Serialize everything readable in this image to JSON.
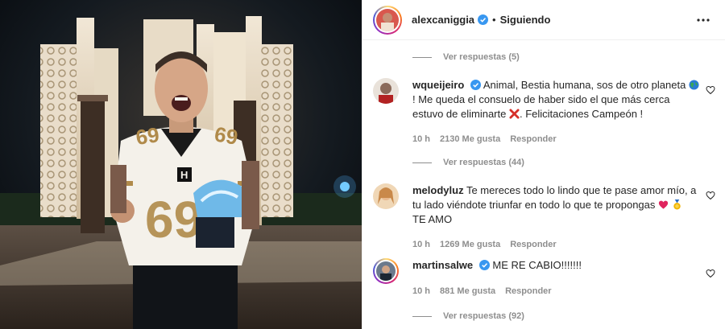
{
  "post": {
    "author": "alexcaniggia",
    "separator": "•",
    "follow_status": "Siguiendo",
    "more_icon": "more-options-icon"
  },
  "threads": [
    {
      "view_replies": "Ver respuestas (5)"
    },
    {
      "view_replies": "Ver respuestas (44)"
    },
    {
      "view_replies": "Ver respuestas (92)"
    }
  ],
  "comments": [
    {
      "user": "wqueijeiro",
      "verified": true,
      "text_part1": "Animal, Bestia humana, sos de otro planeta",
      "text_part2": "! Me queda el consuelo de haber sido el que más cerca estuvo de eliminarte",
      "text_part3": ". Felicitaciones Campeón !",
      "time": "10 h",
      "likes": "2130 Me gusta",
      "reply": "Responder"
    },
    {
      "user": "melodyluz",
      "verified": false,
      "text_part1": "Te mereces todo lo lindo que te pase amor mío, a tu lado viéndote triunfar en todo lo que te propongas",
      "text_part2": "TE AMO",
      "time": "10 h",
      "likes": "1269 Me gusta",
      "reply": "Responder"
    },
    {
      "user": "martinsalwe",
      "verified": true,
      "text_part1": "ME RE CABIO!!!!!!!",
      "time": "10 h",
      "likes": "881 Me gusta",
      "reply": "Responder"
    }
  ],
  "photo": {
    "jersey_number": "69",
    "jersey_letter": "H"
  },
  "colors": {
    "verified_blue": "#3897f0",
    "muted_text": "#8e8e8e",
    "text": "#262626",
    "jersey_gold": "#b08a4a"
  }
}
